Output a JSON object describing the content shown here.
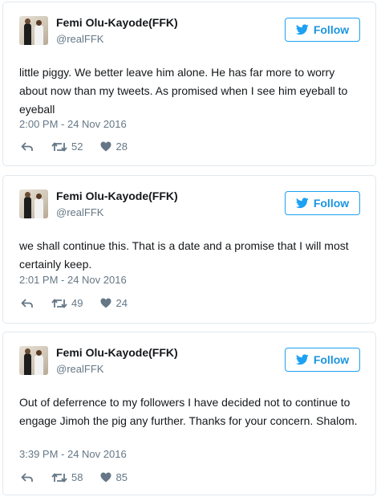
{
  "tweets": [
    {
      "author": "Femi Olu-Kayode(FFK)",
      "handle": "@realFFK",
      "follow_label": "Follow",
      "text": "little piggy. We better leave him alone. He has far more to worry about now than my tweets. As promised when I see him eyeball to eyeball",
      "timestamp": "2:00 PM - 24 Nov 2016",
      "retweets": "52",
      "likes": "28"
    },
    {
      "author": "Femi Olu-Kayode(FFK)",
      "handle": "@realFFK",
      "follow_label": "Follow",
      "text": "we shall continue this. That is a date and a promise that I will most certainly keep.",
      "timestamp": "2:01 PM - 24 Nov 2016",
      "retweets": "49",
      "likes": "24"
    },
    {
      "author": "Femi Olu-Kayode(FFK)",
      "handle": "@realFFK",
      "follow_label": "Follow",
      "text": "Out of deferrence to my followers I have decided not to continue to engage Jimoh the pig any further. Thanks for your concern. Shalom.",
      "timestamp": "3:39 PM - 24 Nov 2016",
      "retweets": "58",
      "likes": "85"
    }
  ],
  "colors": {
    "accent": "#1da1f2",
    "text": "#14171a",
    "muted": "#657786",
    "border": "#e1e8ed"
  },
  "icons": {
    "follow": "twitter-bird-icon",
    "reply": "reply-icon",
    "retweet": "retweet-icon",
    "like": "heart-icon"
  }
}
